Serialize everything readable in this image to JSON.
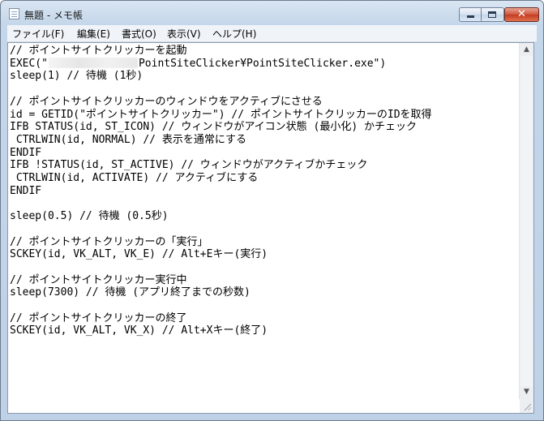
{
  "window": {
    "title": "無題 - メモ帳",
    "icon": "notepad-icon"
  },
  "controls": {
    "minimize_icon": "minimize-icon",
    "maximize_icon": "maximize-icon",
    "close_glyph": "✕"
  },
  "menu": {
    "items": [
      "ファイル(F)",
      "編集(E)",
      "書式(O)",
      "表示(V)",
      "ヘルプ(H)"
    ]
  },
  "editor": {
    "line_before_redaction": "// ポイントサイトクリッカーを起動\nEXEC(\"",
    "line_after_redaction": "PointSiteClicker¥PointSiteClicker.exe\")\nsleep(1) // 待機 (1秒)\n\n// ポイントサイトクリッカーのウィンドウをアクティブにさせる\nid = GETID(\"ポイントサイトクリッカー\") // ポイントサイトクリッカーのIDを取得\nIFB STATUS(id, ST_ICON) // ウィンドウがアイコン状態 (最小化) かチェック\n CTRLWIN(id, NORMAL) // 表示を通常にする\nENDIF\nIFB !STATUS(id, ST_ACTIVE) // ウィンドウがアクティブかチェック\n CTRLWIN(id, ACTIVATE) // アクティブにする\nENDIF\n\nsleep(0.5) // 待機 (0.5秒)\n\n// ポイントサイトクリッカーの「実行」\nSCKEY(id, VK_ALT, VK_E) // Alt+Eキー(実行)\n\n// ポイントサイトクリッカー実行中\nsleep(7300) // 待機 (アプリ終了までの秒数)\n\n// ポイントサイトクリッカーの終了\nSCKEY(id, VK_ALT, VK_X) // Alt+Xキー(終了)"
  },
  "scrollbar": {
    "up_arrow": "▲",
    "down_arrow": "▼"
  }
}
